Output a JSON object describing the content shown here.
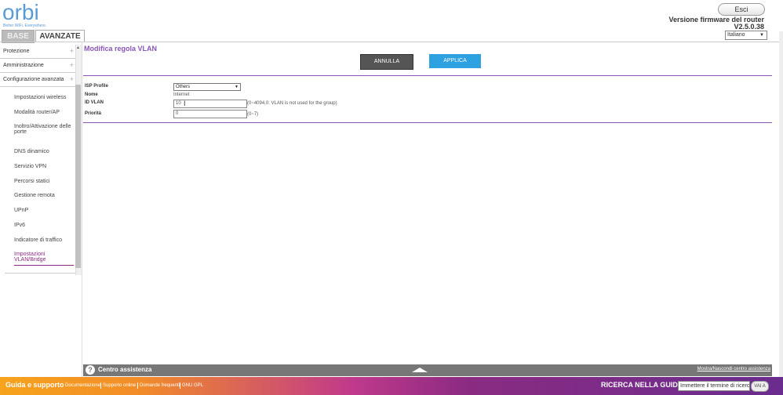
{
  "header": {
    "logo": "orbi",
    "logo_tagline": "Better WiFi. Everywhere.",
    "logout_label": "Esci",
    "firmware_title": "Versione firmware del router",
    "firmware_version": "V2.5.0.38",
    "language": "Italiano",
    "tabs": [
      {
        "label": "BASE"
      },
      {
        "label": "AVANZATE"
      }
    ]
  },
  "sidebar": {
    "sections": [
      {
        "label": "Protezione"
      },
      {
        "label": "Amministrazione"
      },
      {
        "label": "Configurazione avanzata"
      }
    ],
    "items": [
      {
        "label": "Impostazioni wireless"
      },
      {
        "label": "Modalità router/AP"
      },
      {
        "label": "Inoltro/Attivazione delle porte"
      },
      {
        "label": "DNS dinamico"
      },
      {
        "label": "Servizio VPN"
      },
      {
        "label": "Percorsi statici"
      },
      {
        "label": "Gestione remota"
      },
      {
        "label": "UPnP"
      },
      {
        "label": "IPv6"
      },
      {
        "label": "Indicatore di traffico"
      },
      {
        "label": "Impostazioni VLAN/Bridge"
      }
    ]
  },
  "main": {
    "title": "Modifica regola VLAN",
    "cancel_label": "ANNULLA",
    "apply_label": "APPLICA",
    "form": {
      "isp_label": "ISP Profile",
      "isp_value": "Others",
      "name_label": "Nome",
      "name_value": "Internet",
      "vlan_label": "ID VLAN",
      "vlan_value": "10",
      "vlan_hint": "(0~4094,0: VLAN is not used for the group)",
      "priority_label": "Priorità",
      "priority_value": "0",
      "priority_hint": "(0~7)"
    }
  },
  "help": {
    "title": "Centro assistenza",
    "toggle_label": "Mostra/Nascondi centro assistenza"
  },
  "footer": {
    "title": "Guida e supporto",
    "links": [
      "Documentazione",
      "Supporto online",
      "Domande frequenti",
      "GNU GPL"
    ],
    "search_label": "RICERCA NELLA GUIDA",
    "search_placeholder": "Immettere il termine di ricerca",
    "go_label": "VAI A"
  },
  "colors": {
    "accent_purple": "#8a55b8",
    "apply_blue": "#2ea1e0",
    "active_item": "#8a2b82"
  }
}
